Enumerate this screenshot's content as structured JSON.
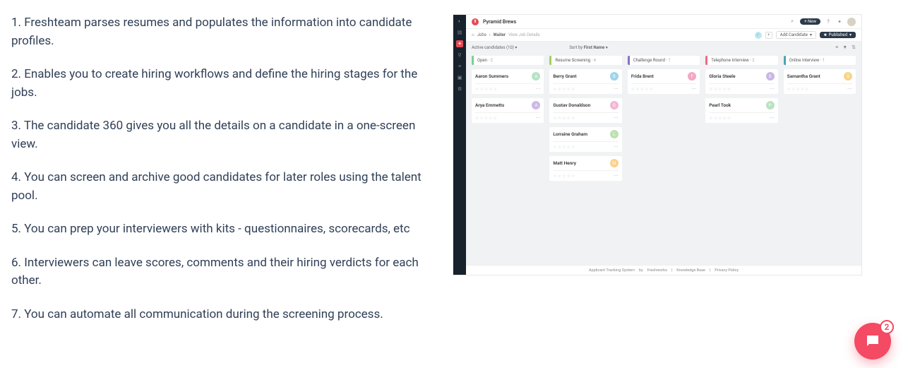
{
  "feature_list": [
    "1. Freshteam parses resumes and populates the information into candidate profiles.",
    "2. Enables you to create hiring workflows and define the hiring stages for the jobs.",
    "3. The candidate 360 gives you all the details on a candidate in a one-screen view.",
    "4. You can screen and archive good candidates for later roles using the talent pool.",
    "5. You can prep your interviewers with kits - questionnaires, scorecards, etc",
    "6. Interviewers can leave scores, comments and their hiring verdicts for each other.",
    "7. You can automate all communication during the screening process."
  ],
  "app": {
    "brand": "Pyramid Brews",
    "topbar": {
      "new_label": "+ New"
    },
    "breadcrumb": {
      "home_icon": "⌂",
      "l1": "Jobs",
      "sep": "›",
      "l2": "Waiter",
      "view": "View Job Details"
    },
    "subbar": {
      "add_candidate": "Add Candidate",
      "published": "Published"
    },
    "filters": {
      "active_label": "Active candidates",
      "active_count": "(10)",
      "sort_label": "Sort by",
      "sort_value": "First Name"
    },
    "columns": [
      {
        "name": "Open",
        "count": "2",
        "accent": "#7ccf8f",
        "cards": [
          {
            "name": "Aaron Summers",
            "initial": "A",
            "color": "#b6e3c6"
          },
          {
            "name": "Arya Emmetts",
            "initial": "A",
            "color": "#cdb8e6"
          }
        ]
      },
      {
        "name": "Resume Screening",
        "count": "4",
        "accent": "#9fd35a",
        "cards": [
          {
            "name": "Berry Grant",
            "initial": "B",
            "color": "#9fd4e8"
          },
          {
            "name": "Gustav Donaldson",
            "initial": "G",
            "color": "#f3b6d3"
          },
          {
            "name": "Lorraine Graham",
            "initial": "L",
            "color": "#bfe0b1"
          },
          {
            "name": "Matt Henry",
            "initial": "M",
            "color": "#ffd08a"
          }
        ]
      },
      {
        "name": "Challenge Round",
        "count": "1",
        "accent": "#8a6fc1",
        "cards": [
          {
            "name": "Frida Brent",
            "initial": "F",
            "color": "#f3a7c3"
          }
        ]
      },
      {
        "name": "Telephone Interview",
        "count": "2",
        "accent": "#f06a7e",
        "cards": [
          {
            "name": "Gloria Steele",
            "initial": "G",
            "color": "#c9b6e6"
          },
          {
            "name": "Pearl Took",
            "initial": "P",
            "color": "#b9e3c0"
          }
        ]
      },
      {
        "name": "Online Interview",
        "count": "1",
        "accent": "#4aa3b5",
        "cards": [
          {
            "name": "Samantha Grant",
            "initial": "S",
            "color": "#f7d48a"
          }
        ]
      }
    ],
    "footer": {
      "a": "Applicant Tracking System",
      "by": "by",
      "brand": "Freshworks",
      "kb": "Knowledge Base",
      "pp": "Privacy Policy"
    }
  },
  "chat": {
    "badge": "2"
  }
}
